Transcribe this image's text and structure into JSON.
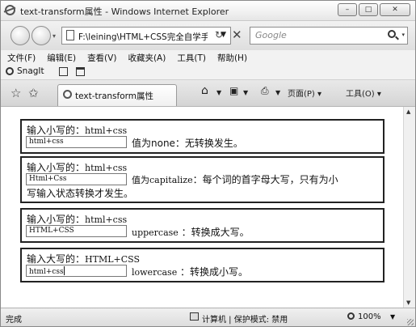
{
  "window": {
    "title": "text-transform属性 - Windows Internet Explorer",
    "minimize": "–",
    "maximize": "□",
    "close": "✕"
  },
  "address": {
    "url": "F:\\leining\\HTML+CSS完全自学手",
    "search_placeholder": "Google"
  },
  "menu": [
    "文件(F)",
    "编辑(E)",
    "查看(V)",
    "收藏夹(A)",
    "工具(T)",
    "帮助(H)"
  ],
  "links_toolbar": {
    "snagit_label": "SnagIt"
  },
  "tab": {
    "label": "text-transform属性"
  },
  "command_bar": {
    "page_label": "页面(P) ▾",
    "tools_label": "工具(O) ▾"
  },
  "boxes": [
    {
      "label_prefix": "输入小写的：",
      "label_code": "html+css",
      "input_value": "html+css",
      "desc_code": "",
      "desc": "值为none：无转换发生。"
    },
    {
      "label_prefix": "输入小写的：",
      "label_code": "html+css",
      "input_value": "Html+Css",
      "desc_code": "值为capitalize",
      "desc": "：每个词的首字母大写，只有为小",
      "desc_wrap": "写输入状态转换才发生。"
    },
    {
      "label_prefix": "输入小写的：",
      "label_code": "html+css",
      "input_value": "HTML+CSS",
      "desc_code": "uppercase",
      "desc": "：转换成大写。"
    },
    {
      "label_prefix": "输入大写的：",
      "label_code": "HTML+CSS",
      "input_value": "html+css",
      "desc_code": "lowercase",
      "desc": "：转换成小写。"
    }
  ],
  "status": {
    "text": "完成",
    "zone": "计算机 | 保护模式: 禁用",
    "zoom": "100%"
  }
}
